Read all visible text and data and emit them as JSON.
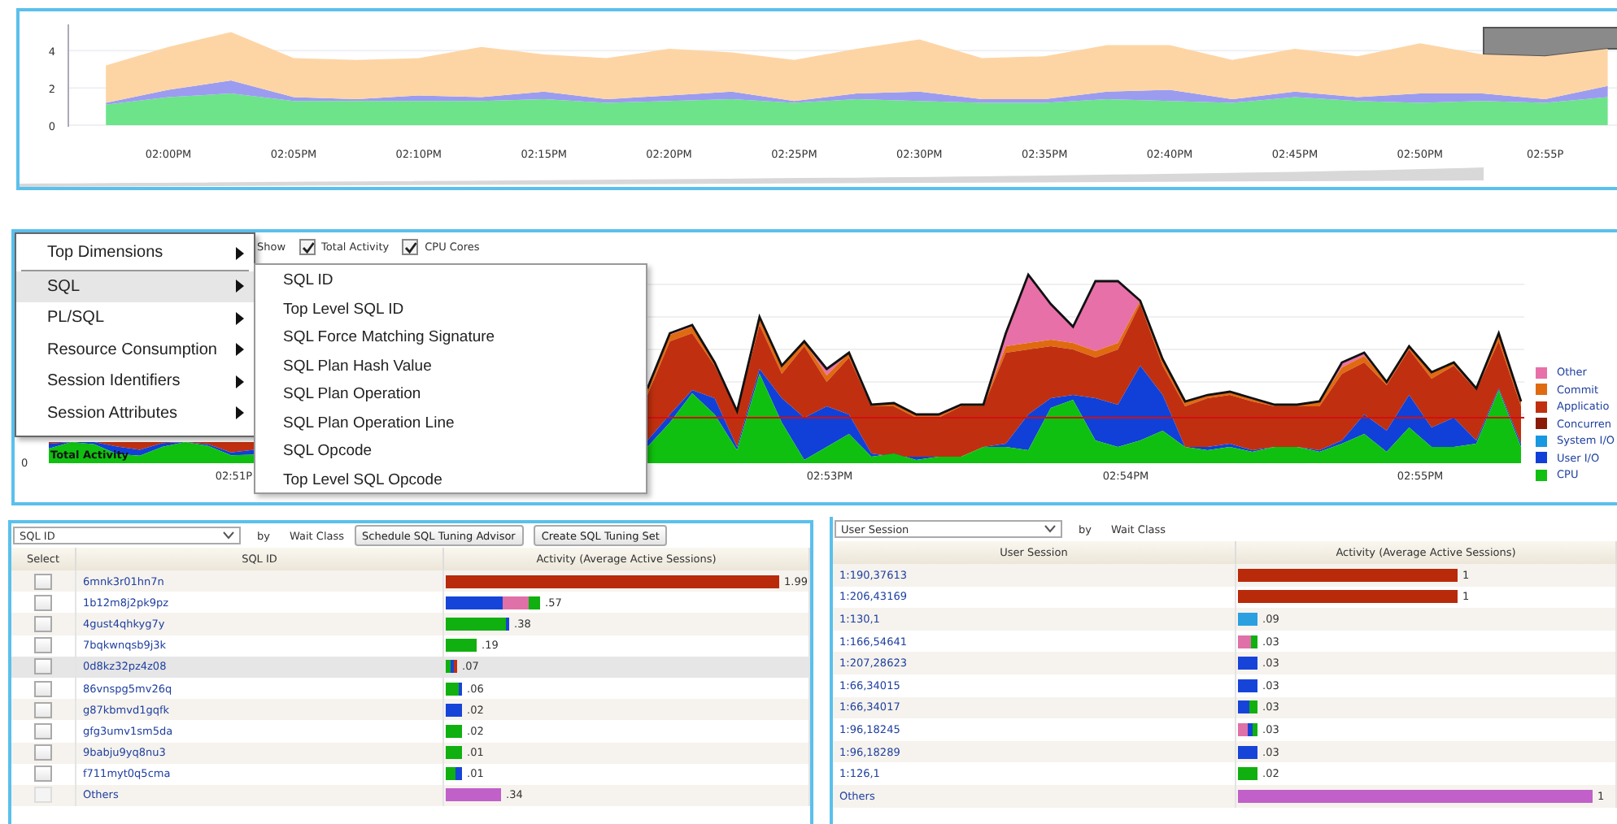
{
  "top_panel": {
    "chart_data": {
      "type": "area",
      "stacked": true,
      "categories": [
        null,
        "02:00PM",
        null,
        "02:05PM",
        null,
        "02:10PM",
        null,
        "02:15PM",
        null,
        "02:20PM",
        null,
        "02:25PM",
        null,
        "02:30PM",
        null,
        "02:35PM",
        null,
        "02:40PM",
        null,
        "02:45PM",
        null,
        "02:50PM",
        null,
        "02:55P",
        null
      ],
      "series": [
        {
          "color": "#6de38a",
          "values": [
            1.1,
            1.5,
            1.7,
            1.3,
            1.3,
            1.3,
            1.3,
            1.4,
            1.2,
            1.3,
            1.4,
            1.2,
            1.4,
            1.3,
            1.2,
            1.2,
            1.4,
            1.3,
            1.2,
            1.5,
            1.3,
            1.2,
            1.3,
            1.2,
            1.5
          ]
        },
        {
          "color": "#9b9cf0",
          "values": [
            0.1,
            0.4,
            0.7,
            0.2,
            0.1,
            0.3,
            0.2,
            0.4,
            0.2,
            0.3,
            0.4,
            0.1,
            0.3,
            0.5,
            0.2,
            0.2,
            0.4,
            0.6,
            0.2,
            0.3,
            0.2,
            0.5,
            0.4,
            0.2,
            0.6
          ]
        },
        {
          "color": "#fdd5a5",
          "values": [
            2.0,
            2.3,
            2.6,
            2.1,
            2.1,
            2.0,
            2.7,
            2.0,
            2.2,
            2.5,
            2.1,
            2.2,
            2.4,
            2.8,
            2.2,
            2.3,
            2.5,
            2.4,
            2.1,
            2.3,
            2.2,
            2.7,
            2.1,
            2.3,
            2.0
          ]
        }
      ],
      "ylim": [
        0,
        5.5
      ],
      "yticks": [
        0,
        2,
        4
      ]
    }
  },
  "middle_panel": {
    "show_label": "Show",
    "show_options": [
      {
        "label": "Total Activity",
        "checked": true
      },
      {
        "label": "CPU Cores",
        "checked": true
      }
    ],
    "y_tick": "0",
    "series_label": "Total Activity",
    "x_ticks": [
      "02:51P",
      "02:53PM",
      "02:54PM",
      "02:55PM"
    ],
    "legend": [
      {
        "label": "Other",
        "color": "#e870a8"
      },
      {
        "label": "Commit",
        "color": "#e06a10"
      },
      {
        "label": "Applicatio",
        "color": "#c03010"
      },
      {
        "label": "Concurren",
        "color": "#8a1a08"
      },
      {
        "label": "System I/O",
        "color": "#1898e0"
      },
      {
        "label": "User I/O",
        "color": "#1040d8"
      },
      {
        "label": "CPU",
        "color": "#10c010"
      }
    ],
    "menu": [
      {
        "label": "Top Dimensions",
        "selected": false
      },
      {
        "label": "SQL",
        "selected": true
      },
      {
        "label": "PL/SQL",
        "selected": false
      },
      {
        "label": "Resource Consumption",
        "selected": false
      },
      {
        "label": "Session Identifiers",
        "selected": false
      },
      {
        "label": "Session Attributes",
        "selected": false
      }
    ],
    "submenu": [
      "SQL ID",
      "Top Level SQL ID",
      "SQL Force Matching Signature",
      "SQL Plan Hash Value",
      "SQL Plan Operation",
      "SQL Plan Operation Line",
      "SQL Opcode",
      "Top Level SQL Opcode"
    ]
  },
  "sql_panel": {
    "dimension": "SQL ID",
    "by_label": "by",
    "group_label": "Wait Class",
    "buttons": [
      "Schedule SQL Tuning Advisor",
      "Create SQL Tuning Set"
    ],
    "columns": [
      "Select",
      "SQL ID",
      "Activity (Average Active Sessions)"
    ],
    "rows": [
      {
        "checked": false,
        "disabled": false,
        "selected": false,
        "id": "6mnk3r01hn7n",
        "value": "1.99",
        "bar": [
          {
            "color": "#b82a0a"
          }
        ]
      },
      {
        "checked": false,
        "disabled": false,
        "selected": false,
        "id": "1b12m8j2pk9pz",
        "value": ".57",
        "bar": [
          {
            "color": "#1744d8"
          },
          {
            "color": "#e070a8"
          },
          {
            "color": "#10b010"
          }
        ]
      },
      {
        "checked": false,
        "disabled": false,
        "selected": false,
        "id": "4gust4qhkyg7y",
        "value": ".38",
        "bar": [
          {
            "color": "#10b010"
          },
          {
            "color": "#1744d8"
          }
        ]
      },
      {
        "checked": false,
        "disabled": false,
        "selected": false,
        "id": "7bqkwnqsb9j3k",
        "value": ".19",
        "bar": [
          {
            "color": "#10b010"
          }
        ]
      },
      {
        "checked": false,
        "disabled": false,
        "selected": true,
        "id": "0d8kz32pz4z08",
        "value": ".07",
        "bar": [
          {
            "color": "#10b010"
          },
          {
            "color": "#1744d8"
          },
          {
            "color": "#c03010"
          }
        ]
      },
      {
        "checked": false,
        "disabled": false,
        "selected": false,
        "id": "86vnspg5mv26q",
        "value": ".06",
        "bar": [
          {
            "color": "#10b010"
          },
          {
            "color": "#1744d8"
          }
        ]
      },
      {
        "checked": false,
        "disabled": false,
        "selected": false,
        "id": "g87kbmvd1gqfk",
        "value": ".02",
        "bar": [
          {
            "color": "#1744d8"
          }
        ]
      },
      {
        "checked": false,
        "disabled": false,
        "selected": false,
        "id": "gfg3umv1sm5da",
        "value": ".02",
        "bar": [
          {
            "color": "#10b010"
          }
        ]
      },
      {
        "checked": false,
        "disabled": false,
        "selected": false,
        "id": "9babju9yq8nu3",
        "value": ".01",
        "bar": [
          {
            "color": "#10b010"
          }
        ]
      },
      {
        "checked": false,
        "disabled": false,
        "selected": false,
        "id": "f711myt0q5cma",
        "value": ".01",
        "bar": [
          {
            "color": "#10b010"
          },
          {
            "color": "#1744d8"
          }
        ]
      },
      {
        "checked": false,
        "disabled": true,
        "selected": false,
        "id": "Others",
        "value": ".34",
        "bar": [
          {
            "color": "#c060c8"
          }
        ]
      }
    ]
  },
  "session_panel": {
    "dimension": "User Session",
    "by_label": "by",
    "group_label": "Wait Class",
    "columns": [
      "User Session",
      "Activity (Average Active Sessions)"
    ],
    "rows": [
      {
        "session": "1:190,37613",
        "value": "1",
        "bar": [
          {
            "color": "#b82a0a"
          }
        ]
      },
      {
        "session": "1:206,43169",
        "value": "1",
        "bar": [
          {
            "color": "#b82a0a"
          }
        ]
      },
      {
        "session": "1:130,1",
        "value": ".09",
        "bar": [
          {
            "color": "#2aa0e0"
          }
        ]
      },
      {
        "session": "1:166,54641",
        "value": ".03",
        "bar": [
          {
            "color": "#e070a8"
          },
          {
            "color": "#10b010"
          }
        ]
      },
      {
        "session": "1:207,28623",
        "value": ".03",
        "bar": [
          {
            "color": "#1744d8"
          }
        ]
      },
      {
        "session": "1:66,34015",
        "value": ".03",
        "bar": [
          {
            "color": "#1744d8"
          }
        ]
      },
      {
        "session": "1:66,34017",
        "value": ".03",
        "bar": [
          {
            "color": "#1744d8"
          },
          {
            "color": "#10b010"
          }
        ]
      },
      {
        "session": "1:96,18245",
        "value": ".03",
        "bar": [
          {
            "color": "#e070a8"
          },
          {
            "color": "#1744d8"
          },
          {
            "color": "#10b010"
          }
        ]
      },
      {
        "session": "1:96,18289",
        "value": ".03",
        "bar": [
          {
            "color": "#1744d8"
          }
        ]
      },
      {
        "session": "1:126,1",
        "value": ".02",
        "bar": [
          {
            "color": "#10b010"
          }
        ]
      },
      {
        "session": "Others",
        "value": "1",
        "bar": [
          {
            "color": "#c060c8"
          }
        ]
      }
    ]
  }
}
